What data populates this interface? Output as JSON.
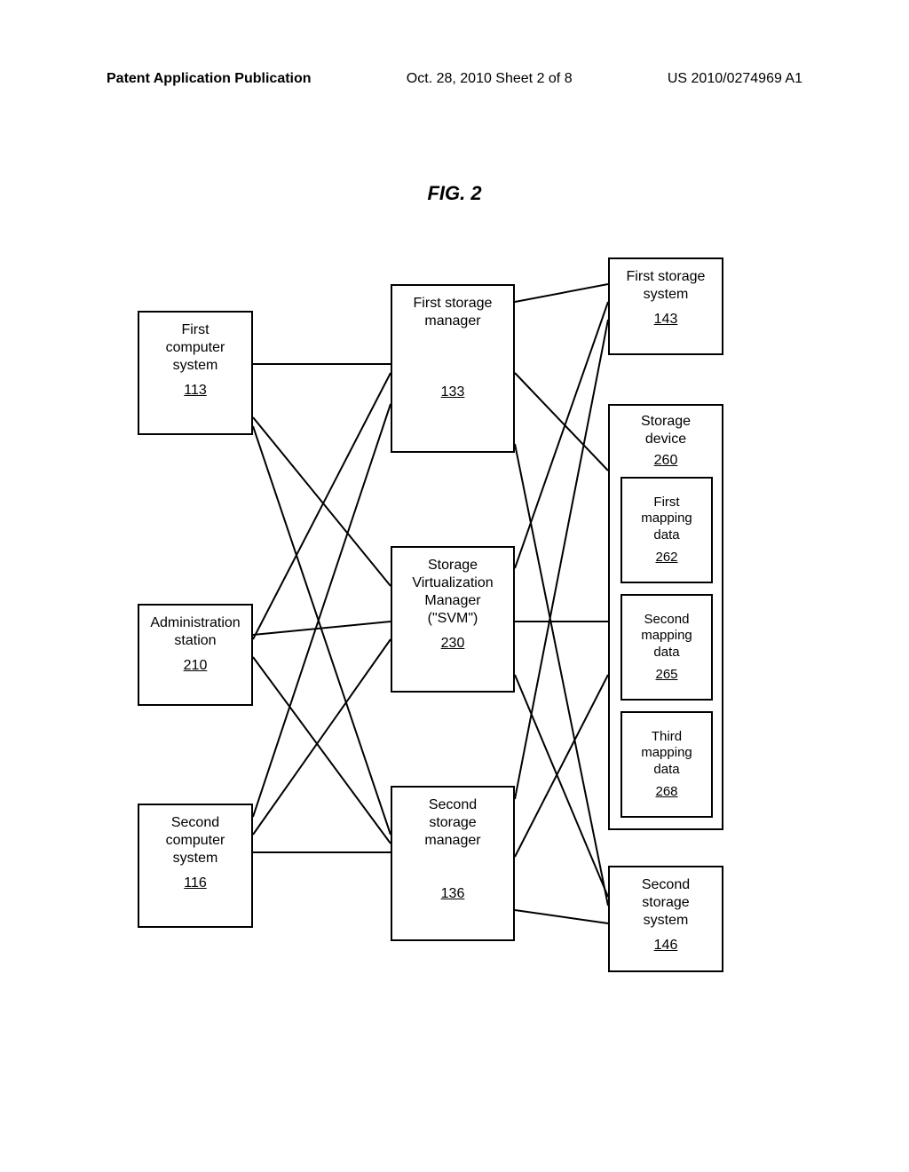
{
  "header": {
    "left": "Patent Application Publication",
    "mid": "Oct. 28, 2010  Sheet 2 of 8",
    "right": "US 2010/0274969 A1"
  },
  "figure": {
    "title": "FIG. 2"
  },
  "boxes": {
    "first_computer": {
      "label": "First\ncomputer\nsystem",
      "ref": "113"
    },
    "admin_station": {
      "label": "Administration\nstation",
      "ref": "210"
    },
    "second_computer": {
      "label": "Second\ncomputer\nsystem",
      "ref": "116"
    },
    "first_storage_mgr": {
      "label": "First storage\nmanager",
      "ref": "133"
    },
    "svm": {
      "label": "Storage\nVirtualization\nManager\n(\"SVM\")",
      "ref": "230"
    },
    "second_storage_mgr": {
      "label": "Second\nstorage\nmanager",
      "ref": "136"
    },
    "first_storage_sys": {
      "label": "First storage\nsystem",
      "ref": "143"
    },
    "storage_device": {
      "label": "Storage\ndevice",
      "ref": "260"
    },
    "first_mapping": {
      "label": "First\nmapping\ndata",
      "ref": "262"
    },
    "second_mapping": {
      "label": "Second\nmapping\ndata",
      "ref": "265"
    },
    "third_mapping": {
      "label": "Third\nmapping\ndata",
      "ref": "268"
    },
    "second_storage_sys": {
      "label": "Second\nstorage\nsystem",
      "ref": "146"
    }
  }
}
